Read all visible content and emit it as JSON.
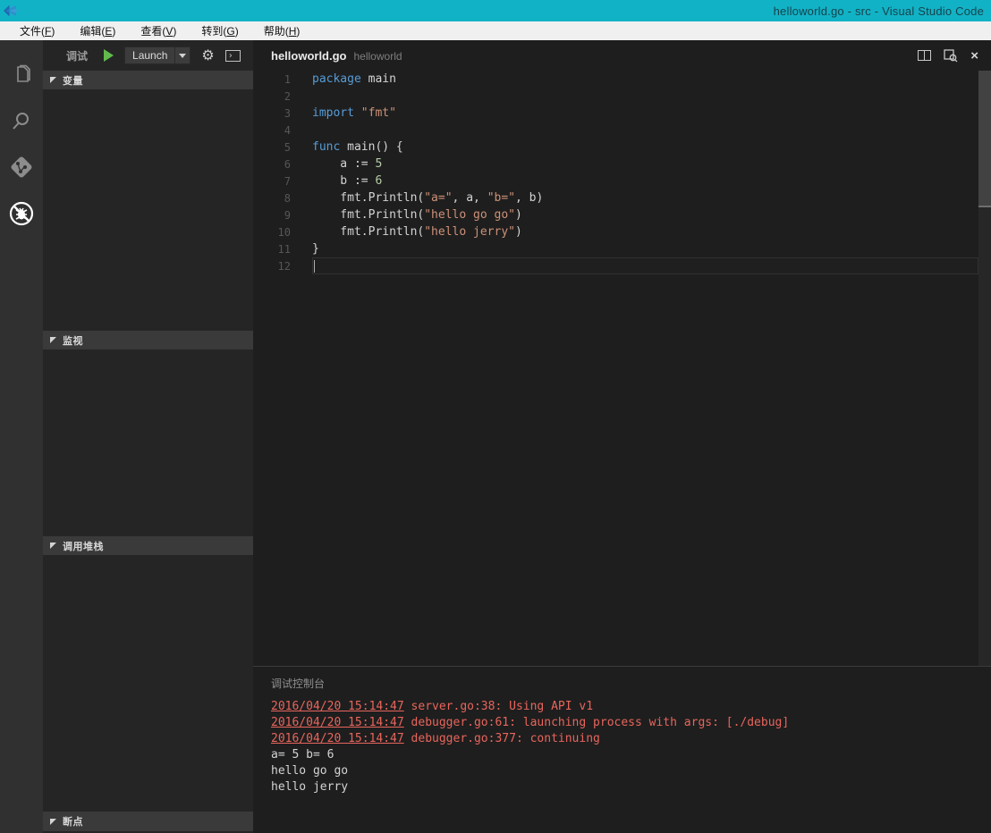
{
  "window": {
    "title": "helloworld.go - src - Visual Studio Code",
    "titlebar_color": "#12b2c6",
    "logo_icon": "vscode-logo-icon"
  },
  "menu": {
    "items": [
      {
        "label": "文件",
        "accel": "F"
      },
      {
        "label": "编辑",
        "accel": "E"
      },
      {
        "label": "查看",
        "accel": "V"
      },
      {
        "label": "转到",
        "accel": "G"
      },
      {
        "label": "帮助",
        "accel": "H"
      }
    ]
  },
  "activity_bar": {
    "items": [
      {
        "icon": "explorer-files-icon",
        "active": false
      },
      {
        "icon": "search-icon",
        "active": false
      },
      {
        "icon": "source-control-git-icon",
        "active": false
      },
      {
        "icon": "debug-no-bug-icon",
        "active": true
      }
    ]
  },
  "debug_sidebar": {
    "title": "调试",
    "play_icon": "start-debugging-icon",
    "launch_label": "Launch",
    "gear_icon": "configure-launch-icon",
    "console_icon": "open-debug-console-icon",
    "sections": [
      {
        "label": "变量"
      },
      {
        "label": "监视"
      },
      {
        "label": "调用堆栈"
      },
      {
        "label": "断点"
      }
    ]
  },
  "editor": {
    "tab": {
      "filename": "helloworld.go",
      "folder": "helloworld"
    },
    "actions": {
      "split_icon": "split-editor-icon",
      "preview_icon": "preview-search-icon",
      "close_icon": "close-icon"
    },
    "active_line": 12,
    "language": "go",
    "lines": [
      [
        {
          "s": "package",
          "c": "kw"
        },
        {
          "s": " main",
          "c": "pl"
        }
      ],
      [],
      [
        {
          "s": "import",
          "c": "kw"
        },
        {
          "s": " ",
          "c": "pl"
        },
        {
          "s": "\"fmt\"",
          "c": "str"
        }
      ],
      [],
      [
        {
          "s": "func",
          "c": "kw"
        },
        {
          "s": " main() {",
          "c": "pl"
        }
      ],
      [
        {
          "s": "    a := ",
          "c": "pl"
        },
        {
          "s": "5",
          "c": "num"
        }
      ],
      [
        {
          "s": "    b := ",
          "c": "pl"
        },
        {
          "s": "6",
          "c": "num"
        }
      ],
      [
        {
          "s": "    fmt.Println(",
          "c": "pl"
        },
        {
          "s": "\"a=\"",
          "c": "str"
        },
        {
          "s": ", a, ",
          "c": "pl"
        },
        {
          "s": "\"b=\"",
          "c": "str"
        },
        {
          "s": ", b)",
          "c": "pl"
        }
      ],
      [
        {
          "s": "    fmt.Println(",
          "c": "pl"
        },
        {
          "s": "\"hello go go\"",
          "c": "str"
        },
        {
          "s": ")",
          "c": "pl"
        }
      ],
      [
        {
          "s": "    fmt.Println(",
          "c": "pl"
        },
        {
          "s": "\"hello jerry\"",
          "c": "str"
        },
        {
          "s": ")",
          "c": "pl"
        }
      ],
      [
        {
          "s": "}",
          "c": "pl"
        }
      ],
      []
    ]
  },
  "debug_console": {
    "title": "调试控制台",
    "lines": [
      {
        "type": "log",
        "timestamp": "2016/04/20 15:14:47",
        "text": " server.go:38: Using API v1"
      },
      {
        "type": "log",
        "timestamp": "2016/04/20 15:14:47",
        "text": " debugger.go:61: launching process with args: [./debug]"
      },
      {
        "type": "log",
        "timestamp": "2016/04/20 15:14:47",
        "text": " debugger.go:377: continuing"
      },
      {
        "type": "stdout",
        "text": "a= 5 b= 6"
      },
      {
        "type": "stdout",
        "text": "hello go go"
      },
      {
        "type": "stdout",
        "text": "hello jerry"
      }
    ]
  },
  "colors": {
    "titlebar": "#12b2c6",
    "editor_bg": "#1e1e1e",
    "sidebar_bg": "#252526",
    "section_header_bg": "#3a3a3a",
    "keyword": "#569cd6",
    "string": "#ce9178",
    "number": "#b5cea8",
    "console_error": "#e8655c",
    "play_green": "#61b94c"
  }
}
